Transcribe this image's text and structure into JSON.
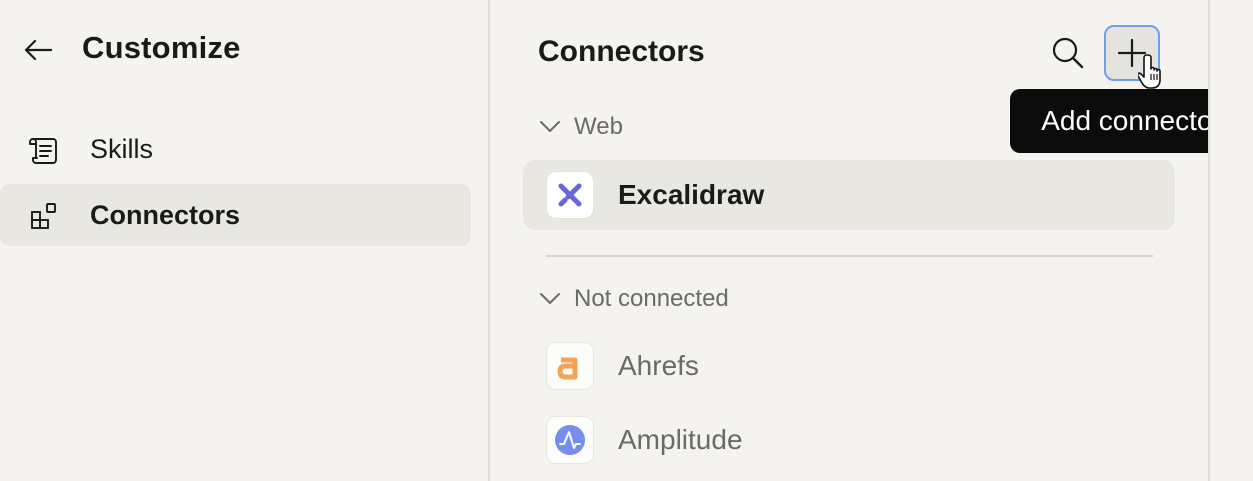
{
  "left": {
    "title": "Customize",
    "nav": [
      {
        "label": "Skills",
        "icon": "scroll-icon",
        "active": false
      },
      {
        "label": "Connectors",
        "icon": "connectors-icon",
        "active": true
      }
    ]
  },
  "main": {
    "title": "Connectors",
    "tooltip": "Add connector",
    "groups": [
      {
        "label": "Web",
        "items": [
          {
            "label": "Excalidraw",
            "icon": "excalidraw-logo-icon",
            "color": "#6965db",
            "active": true
          }
        ]
      },
      {
        "label": "Not connected",
        "items": [
          {
            "label": "Ahrefs",
            "icon": "ahrefs-logo-icon",
            "color": "#f08a24"
          },
          {
            "label": "Amplitude",
            "icon": "amplitude-logo-icon",
            "color": "#4b6cf0"
          }
        ]
      }
    ]
  }
}
